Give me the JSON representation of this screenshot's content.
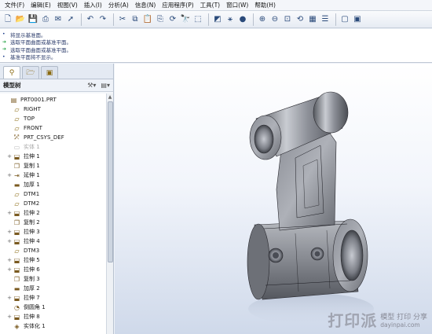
{
  "menubar": {
    "items": [
      "文件(F)",
      "编辑(E)",
      "视图(V)",
      "插入(I)",
      "分析(A)",
      "信息(N)",
      "应用程序(P)",
      "工具(T)",
      "窗口(W)",
      "帮助(H)"
    ]
  },
  "messages": [
    {
      "icon": "bullet",
      "text": "将显示基准面。"
    },
    {
      "icon": "ok",
      "text": "选取平面曲面或基准平面。"
    },
    {
      "icon": "ok",
      "text": "选取平面曲面或基准平面。"
    },
    {
      "icon": "bullet",
      "text": "基准平面将不显示。"
    }
  ],
  "model_tree": {
    "title": "模型树",
    "items": [
      {
        "label": "PRT0001.PRT",
        "icon": "part",
        "expander": "",
        "dim": false
      },
      {
        "label": "RIGHT",
        "icon": "datum-plane",
        "expander": "",
        "dim": false
      },
      {
        "label": "TOP",
        "icon": "datum-plane",
        "expander": "",
        "dim": false
      },
      {
        "label": "FRONT",
        "icon": "datum-plane",
        "expander": "",
        "dim": false
      },
      {
        "label": "PRT_CSYS_DEF",
        "icon": "csys",
        "expander": "",
        "dim": false
      },
      {
        "label": "实体 1",
        "icon": "solid",
        "expander": "",
        "dim": true
      },
      {
        "label": "拉伸 1",
        "icon": "extrude",
        "expander": "+",
        "dim": false
      },
      {
        "label": "复制 1",
        "icon": "copy",
        "expander": "",
        "dim": false
      },
      {
        "label": "延伸 1",
        "icon": "extend",
        "expander": "+",
        "dim": false
      },
      {
        "label": "加厚 1",
        "icon": "thicken",
        "expander": "",
        "dim": false
      },
      {
        "label": "DTM1",
        "icon": "datum-plane",
        "expander": "",
        "dim": false
      },
      {
        "label": "DTM2",
        "icon": "datum-plane",
        "expander": "",
        "dim": false
      },
      {
        "label": "拉伸 2",
        "icon": "extrude",
        "expander": "+",
        "dim": false
      },
      {
        "label": "复制 2",
        "icon": "copy",
        "expander": "",
        "dim": false
      },
      {
        "label": "拉伸 3",
        "icon": "extrude",
        "expander": "+",
        "dim": false
      },
      {
        "label": "拉伸 4",
        "icon": "extrude",
        "expander": "+",
        "dim": false
      },
      {
        "label": "DTM3",
        "icon": "datum-plane",
        "expander": "",
        "dim": false
      },
      {
        "label": "拉伸 5",
        "icon": "extrude",
        "expander": "+",
        "dim": false
      },
      {
        "label": "拉伸 6",
        "icon": "extrude",
        "expander": "+",
        "dim": false
      },
      {
        "label": "复制 3",
        "icon": "copy",
        "expander": "",
        "dim": false
      },
      {
        "label": "加厚 2",
        "icon": "thicken",
        "expander": "",
        "dim": false
      },
      {
        "label": "拉伸 7",
        "icon": "extrude",
        "expander": "+",
        "dim": false
      },
      {
        "label": "倒圆角 1",
        "icon": "round",
        "expander": "",
        "dim": false
      },
      {
        "label": "拉伸 8",
        "icon": "extrude",
        "expander": "+",
        "dim": false
      },
      {
        "label": "实体化 1",
        "icon": "solidify",
        "expander": "",
        "dim": false
      }
    ]
  },
  "watermark": {
    "big": "打印派",
    "small": "模型 打印 分享",
    "url": "dayinpai.com"
  },
  "colors": {
    "tree_icon": "#7a5a20",
    "datum": "#8a6a10",
    "accent": "#2a4a7a"
  }
}
